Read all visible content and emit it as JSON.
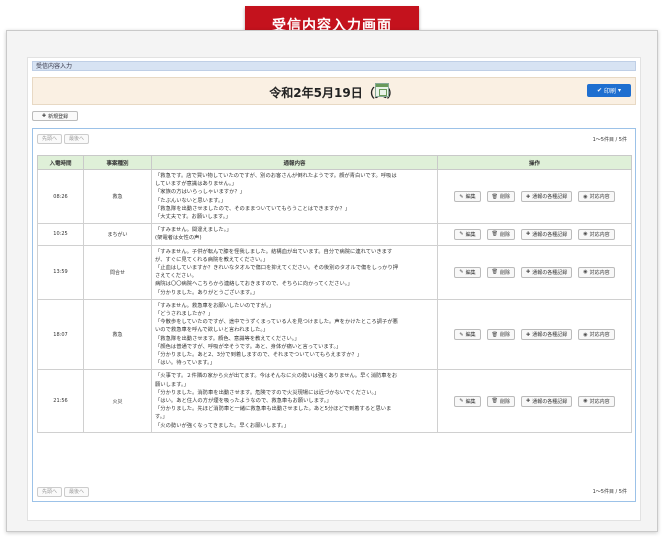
{
  "banner": {
    "title": "受信内容入力画面"
  },
  "breadcrumb": "受信内容入力",
  "date_bar": {
    "date": "令和2年5月19日（火）",
    "print_label": "印刷"
  },
  "new_button": "新規登録",
  "pager": {
    "first": "先頭へ",
    "last": "最後へ",
    "count": "1〜5件目 / 5件"
  },
  "table": {
    "headers": {
      "time": "入電時間",
      "type": "事案種別",
      "content": "通報内容",
      "ops": "操作"
    },
    "op_labels": {
      "edit": "編集",
      "delete": "削除",
      "record": "通報の各種記録",
      "response": "対応内容"
    },
    "rows": [
      {
        "time": "08:26",
        "type": "救急",
        "lines": [
          "「救急です。店で買い物していたのですが、別のお客さんが倒れたようです。顔が青白いです。呼吸は",
          "していますが意識はありません。」",
          "「家族の方はいらっしゃいますか？」",
          "「たぶんいないと思います。」",
          "「救急隊を出動させましたので、そのままついていてもらうことはできますか？」",
          "「大丈夫です。お願いします。」"
        ]
      },
      {
        "time": "10:25",
        "type": "まちがい",
        "lines": [
          "「すみません。間違えました。」",
          "(架電者は女性の声)"
        ]
      },
      {
        "time": "13:59",
        "type": "問合せ",
        "lines": [
          "「すみません。子供が転んで膝を怪我しました。結構血が出ています。自分で病院に連れていきます",
          "が、すぐに見てくれる病院を教えてください。」",
          "「止血はしていますか？きれいなタオルで傷口を抑えてください。その後別のタオルで傷をしっかり押",
          "さえてください。",
          "病院は〇〇病院へこちらから連絡しておきますので、そちらに向かってください。」",
          "「分かりました。ありがとうございます。」"
        ]
      },
      {
        "time": "18:07",
        "type": "救急",
        "lines": [
          "「すみません。救急車をお願いしたいのですが。」",
          "「どうされましたか？」",
          "「今散歩をしていたのですが、途中でうずくまっている人を見つけました。声をかけたところ調子が悪",
          "いので救急車を呼んで欲しいと言われました。」",
          "「救急隊を出動させます。顔色、意識等を教えてください。」",
          "「顔色は普通ですが、呼吸が辛そうです。あと、身体が痛いと言っています。」",
          "「分かりました。あと2、3分で到着しますので、それまでついていてもらえますか？」",
          "「はい。待っています。」"
        ]
      },
      {
        "time": "21:56",
        "type": "火災",
        "lines": [
          "「火事です。２件隣の家から火が出てます。今はそんなに火の勢いは強くありません。早く消防車をお",
          "願いします。」",
          "「分かりました。消防車を出動させます。危険ですので火災現場には近づかないでください。」",
          "「はい。あと住人の方が煙を吸ったようなので、救急車もお願いします。」",
          "「分かりました。先ほど消防車と一緒に救急車も出動させました。あと5分ほどで到着すると思いま",
          "す。」",
          "「火の勢いが強くなってきました。早くお願いします。」"
        ]
      }
    ]
  }
}
